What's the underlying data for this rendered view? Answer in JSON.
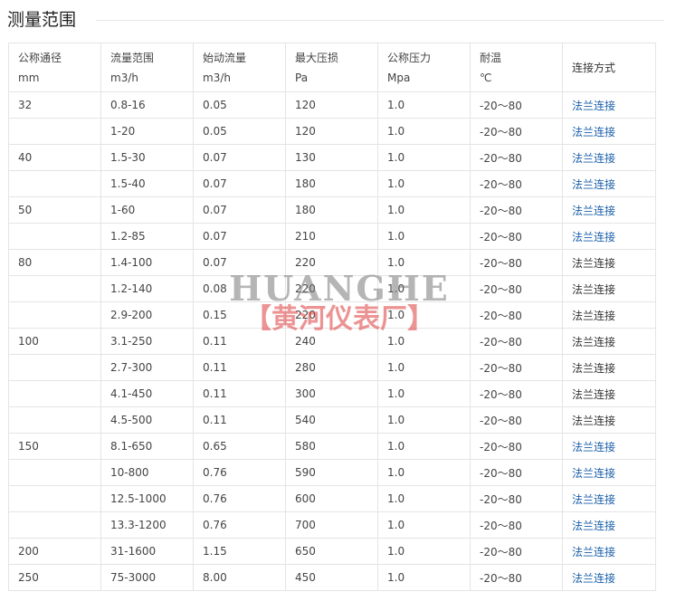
{
  "title": "测量范围",
  "table": {
    "headers": [
      {
        "label": "公称通径",
        "unit": "mm"
      },
      {
        "label": "流量范围",
        "unit": "m3/h"
      },
      {
        "label": "始动流量",
        "unit": "m3/h"
      },
      {
        "label": "最大压损",
        "unit": "Pa"
      },
      {
        "label": "公称压力",
        "unit": "Mpa"
      },
      {
        "label": "耐温",
        "unit": "℃"
      },
      {
        "label": "连接方式",
        "unit": ""
      }
    ],
    "rows": [
      {
        "dn": "32",
        "flow": "0.8-16",
        "start": "0.05",
        "loss": "120",
        "pressure": "1.0",
        "temp": "-20～80",
        "conn": "法兰连接",
        "link": true
      },
      {
        "dn": "",
        "flow": "1-20",
        "start": "0.05",
        "loss": "120",
        "pressure": "1.0",
        "temp": "-20～80",
        "conn": "法兰连接",
        "link": true
      },
      {
        "dn": "40",
        "flow": "1.5-30",
        "start": "0.07",
        "loss": "130",
        "pressure": "1.0",
        "temp": "-20～80",
        "conn": "法兰连接",
        "link": true
      },
      {
        "dn": "",
        "flow": "1.5-40",
        "start": "0.07",
        "loss": "180",
        "pressure": "1.0",
        "temp": "-20～80",
        "conn": "法兰连接",
        "link": true
      },
      {
        "dn": "50",
        "flow": "1-60",
        "start": "0.07",
        "loss": "180",
        "pressure": "1.0",
        "temp": "-20～80",
        "conn": "法兰连接",
        "link": true
      },
      {
        "dn": "",
        "flow": "1.2-85",
        "start": "0.07",
        "loss": "210",
        "pressure": "1.0",
        "temp": "-20～80",
        "conn": "法兰连接",
        "link": true
      },
      {
        "dn": "80",
        "flow": "1.4-100",
        "start": "0.07",
        "loss": "220",
        "pressure": "1.0",
        "temp": "-20～80",
        "conn": "法兰连接",
        "link": false
      },
      {
        "dn": "",
        "flow": "1.2-140",
        "start": "0.08",
        "loss": "220",
        "pressure": "1.0",
        "temp": "-20～80",
        "conn": "法兰连接",
        "link": false
      },
      {
        "dn": "",
        "flow": "2.9-200",
        "start": "0.15",
        "loss": "220",
        "pressure": "1.0",
        "temp": "-20～80",
        "conn": "法兰连接",
        "link": false
      },
      {
        "dn": "100",
        "flow": "3.1-250",
        "start": "0.11",
        "loss": "240",
        "pressure": "1.0",
        "temp": "-20～80",
        "conn": "法兰连接",
        "link": false
      },
      {
        "dn": "",
        "flow": "2.7-300",
        "start": "0.11",
        "loss": "280",
        "pressure": "1.0",
        "temp": "-20～80",
        "conn": "法兰连接",
        "link": false
      },
      {
        "dn": "",
        "flow": "4.1-450",
        "start": "0.11",
        "loss": "300",
        "pressure": "1.0",
        "temp": "-20～80",
        "conn": "法兰连接",
        "link": false
      },
      {
        "dn": "",
        "flow": "4.5-500",
        "start": "0.11",
        "loss": "540",
        "pressure": "1.0",
        "temp": "-20～80",
        "conn": "法兰连接",
        "link": false
      },
      {
        "dn": "150",
        "flow": "8.1-650",
        "start": "0.65",
        "loss": "580",
        "pressure": "1.0",
        "temp": "-20～80",
        "conn": "法兰连接",
        "link": true
      },
      {
        "dn": "",
        "flow": "10-800",
        "start": "0.76",
        "loss": "590",
        "pressure": "1.0",
        "temp": "-20～80",
        "conn": "法兰连接",
        "link": true
      },
      {
        "dn": "",
        "flow": "12.5-1000",
        "start": "0.76",
        "loss": "600",
        "pressure": "1.0",
        "temp": "-20～80",
        "conn": "法兰连接",
        "link": true
      },
      {
        "dn": "",
        "flow": "13.3-1200",
        "start": "0.76",
        "loss": "700",
        "pressure": "1.0",
        "temp": "-20～80",
        "conn": "法兰连接",
        "link": true
      },
      {
        "dn": "200",
        "flow": "31-1600",
        "start": "1.15",
        "loss": "650",
        "pressure": "1.0",
        "temp": "-20～80",
        "conn": "法兰连接",
        "link": true
      },
      {
        "dn": "250",
        "flow": "75-3000",
        "start": "8.00",
        "loss": "450",
        "pressure": "1.0",
        "temp": "-20～80",
        "conn": "法兰连接",
        "link": true
      }
    ]
  },
  "watermark": {
    "brand_en": "HUANGHE",
    "brand_cn": "【黄河仪表厂】"
  },
  "colors": {
    "link": "#1a5fa8",
    "border": "#e4e4e4",
    "watermark_red": "#dc3c3c"
  }
}
